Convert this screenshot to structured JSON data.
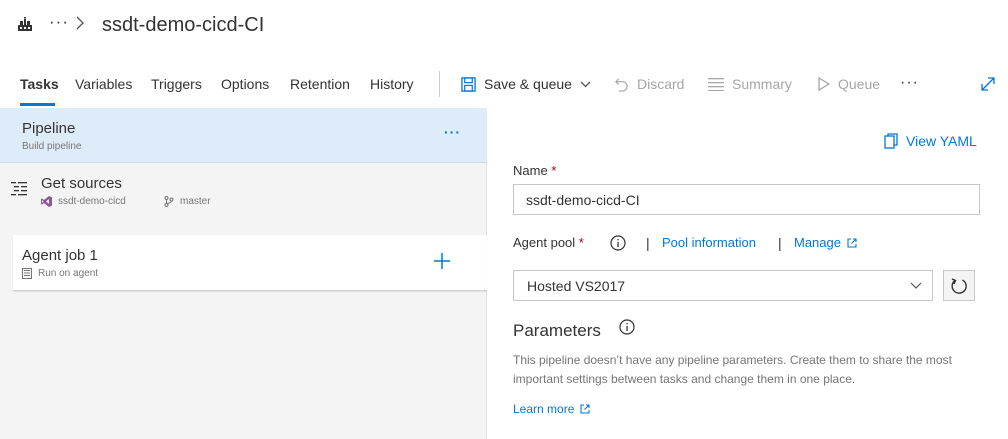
{
  "header": {
    "app_icon": "pipeline-app-icon",
    "more_label": "···",
    "chevron_icon": "chevron-right-icon",
    "title": "ssdt-demo-cicd-CI"
  },
  "toolbar": {
    "tabs": [
      {
        "label": "Tasks",
        "active": true
      },
      {
        "label": "Variables",
        "active": false
      },
      {
        "label": "Triggers",
        "active": false
      },
      {
        "label": "Options",
        "active": false
      },
      {
        "label": "Retention",
        "active": false
      },
      {
        "label": "History",
        "active": false
      }
    ],
    "save_queue": {
      "label": "Save & queue",
      "icon": "save-icon",
      "enabled": true
    },
    "discard": {
      "label": "Discard",
      "icon": "undo-icon",
      "enabled": false
    },
    "summary": {
      "label": "Summary",
      "icon": "list-icon",
      "enabled": false
    },
    "queue": {
      "label": "Queue",
      "icon": "play-icon",
      "enabled": false
    },
    "more_label": "···",
    "expand_icon": "expand-icon"
  },
  "pipeline": {
    "title": "Pipeline",
    "subtitle": "Build pipeline",
    "more_label": "···"
  },
  "get_sources": {
    "title": "Get sources",
    "repo": "ssdt-demo-cicd",
    "branch": "master"
  },
  "agent_job": {
    "title": "Agent job 1",
    "subtitle": "Run on agent"
  },
  "details": {
    "view_yaml": "View YAML",
    "name_label": "Name",
    "required_mark": "*",
    "name_value": "ssdt-demo-cicd-CI",
    "agent_pool_label": "Agent pool",
    "pipe_sep": "|",
    "pool_info_link": "Pool information",
    "manage_link": "Manage",
    "agent_pool_value": "Hosted VS2017",
    "parameters_title": "Parameters",
    "parameters_desc": "This pipeline doesn’t have any pipeline parameters. Create them to share the most important settings between tasks and change them in one place.",
    "learn_more": "Learn more"
  },
  "colors": {
    "accent": "#0078d4",
    "selected_bg": "#deecf9",
    "panel_bg": "#f4f4f4",
    "required": "#a80000",
    "disabled": "#a6a6a6"
  }
}
